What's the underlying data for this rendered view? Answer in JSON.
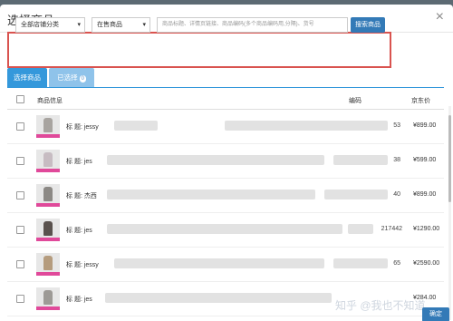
{
  "dialog": {
    "title": "选择商品",
    "close": "×"
  },
  "filter": {
    "category_select": "全部店铺分类",
    "status_select": "在售商品",
    "search_placeholder": "商品标题、详情页链接、商品编码(多个商品编码用,分隔)、货号",
    "search_button": "搜索商品"
  },
  "tabs": {
    "select": "选择商品",
    "selected": "已选择",
    "selected_count": "0"
  },
  "table": {
    "headers": {
      "info": "商品信息",
      "code": "编码",
      "price": "京东价"
    },
    "rows": [
      {
        "title": "标 题: jessy",
        "code": "53",
        "price": "¥899.00"
      },
      {
        "title": "标 题: jes",
        "code": "38",
        "price": "¥599.00"
      },
      {
        "title": "标 题: 杰西",
        "code": "40",
        "price": "¥899.00"
      },
      {
        "title": "标 题: jes",
        "code": "217442",
        "price": "¥1290.00"
      },
      {
        "title": "标 题: jessy",
        "code": "65",
        "price": "¥2590.00"
      },
      {
        "title": "标 题: jes",
        "code": "",
        "price": "¥284.00"
      }
    ]
  },
  "footer": {
    "confirm": "确定"
  },
  "watermark": "知乎 @我也不知道",
  "colors": {
    "primary": "#337ab7",
    "tab_active": "#3498db",
    "highlight_border": "#d9534f"
  }
}
